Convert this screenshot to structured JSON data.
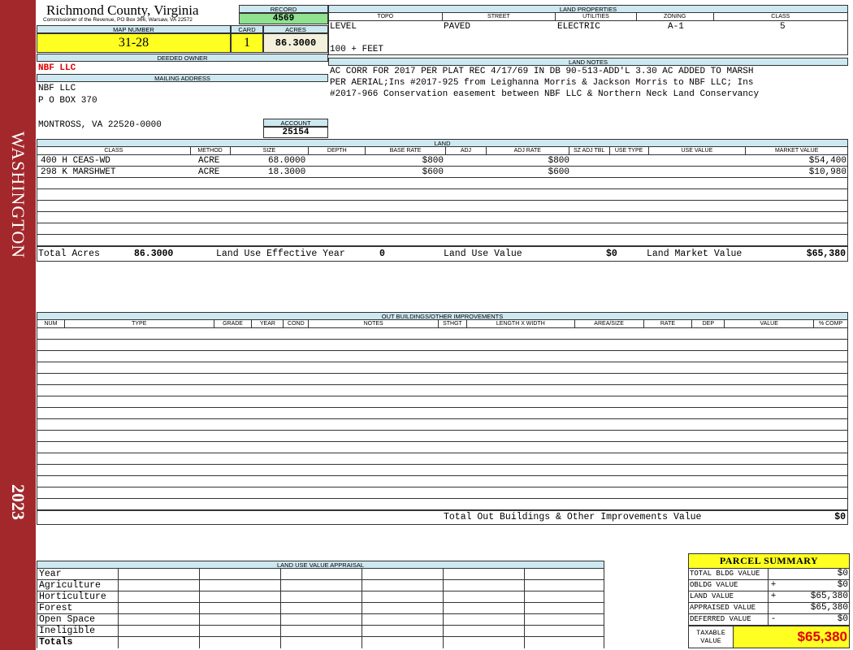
{
  "sidebar": {
    "county": "WASHINGTON",
    "year": "2023"
  },
  "header": {
    "county_title": "Richmond County, Virginia",
    "county_sub": "Commissioner of the Revenue, PO Box 366, Warsaw, VA 22572",
    "record_label": "RECORD",
    "record": "4569",
    "map_number_label": "MAP NUMBER",
    "map_number": "31-28",
    "card_label": "CARD",
    "card": "1",
    "acres_label": "ACRES",
    "acres": "86.3000"
  },
  "owner": {
    "deeded_label": "DEEDED OWNER",
    "deeded": "NBF LLC",
    "mailing_label": "MAILING ADDRESS",
    "mailing_line1": "NBF LLC",
    "mailing_line2": "P O BOX 370",
    "mailing_line3": "MONTROSS, VA 22520-0000",
    "account_label": "ACCOUNT",
    "account": "25154"
  },
  "land_properties": {
    "label": "LAND PROPERTIES",
    "headers": [
      "TOPO",
      "STREET",
      "UTILITIES",
      "ZONING",
      "CLASS"
    ],
    "topo": "LEVEL",
    "street": "PAVED",
    "utilities": "ELECTRIC",
    "zoning": "A-1",
    "class": "5",
    "frontage": "100 + FEET"
  },
  "land_notes": {
    "label": "LAND NOTES",
    "line1": "AC CORR FOR 2017 PER PLAT REC 4/17/69 IN DB 90-513-ADD'L 3.30 AC ADDED TO MARSH",
    "line2": "PER AERIAL;Ins #2017-925 from Leighanna Morris & Jackson Morris to NBF LLC; Ins",
    "line3": "#2017-966 Conservation easement between NBF LLC & Northern Neck Land Conservancy"
  },
  "land": {
    "label": "LAND",
    "headers": [
      "CLASS",
      "METHOD",
      "SIZE",
      "DEPTH",
      "BASE RATE",
      "ADJ",
      "ADJ RATE",
      "SZ ADJ TBL",
      "USE TYPE",
      "USE VALUE",
      "MARKET VALUE"
    ],
    "rows": [
      {
        "class": "400 H CEAS-WD",
        "method": "ACRE",
        "size": "68.0000",
        "base_rate": "$800",
        "adj_rate": "$800",
        "market_value": "$54,400"
      },
      {
        "class": "298 K MARSHWET",
        "method": "ACRE",
        "size": "18.3000",
        "base_rate": "$600",
        "adj_rate": "$600",
        "market_value": "$10,980"
      }
    ],
    "totals": {
      "acres_label": "Total Acres",
      "acres": "86.3000",
      "use_year_label": "Land Use Effective Year",
      "use_year": "0",
      "use_value_label": "Land Use Value",
      "use_value": "$0",
      "market_label": "Land Market Value",
      "market": "$65,380"
    }
  },
  "outbuildings": {
    "label": "OUT BUILDINGS/OTHER IMPROVEMENTS",
    "headers": [
      "NUM",
      "TYPE",
      "GRADE",
      "YEAR",
      "COND",
      "NOTES",
      "STHGT",
      "LENGTH X WIDTH",
      "AREA/SIZE",
      "RATE",
      "DEP",
      "VALUE",
      "% COMP"
    ],
    "total_label": "Total Out Buildings & Other Improvements Value",
    "total": "$0"
  },
  "land_use_appraisal": {
    "label": "LAND USE VALUE APPRAISAL",
    "rows": [
      "Year",
      "Agriculture",
      "Horticulture",
      "Forest",
      "Open Space",
      "Ineligible",
      "Totals"
    ]
  },
  "parcel_summary": {
    "title": "PARCEL SUMMARY",
    "rows": [
      {
        "label": "TOTAL BLDG VALUE",
        "sign": "",
        "value": "$0"
      },
      {
        "label": "OBLDG VALUE",
        "sign": "+",
        "value": "$0"
      },
      {
        "label": "LAND VALUE",
        "sign": "+",
        "value": "$65,380"
      },
      {
        "label": "APPRAISED VALUE",
        "sign": "",
        "value": "$65,380"
      },
      {
        "label": "DEFERRED VALUE",
        "sign": "-",
        "value": "$0"
      }
    ],
    "taxable_label": "TAXABLE VALUE",
    "taxable": "$65,380"
  }
}
